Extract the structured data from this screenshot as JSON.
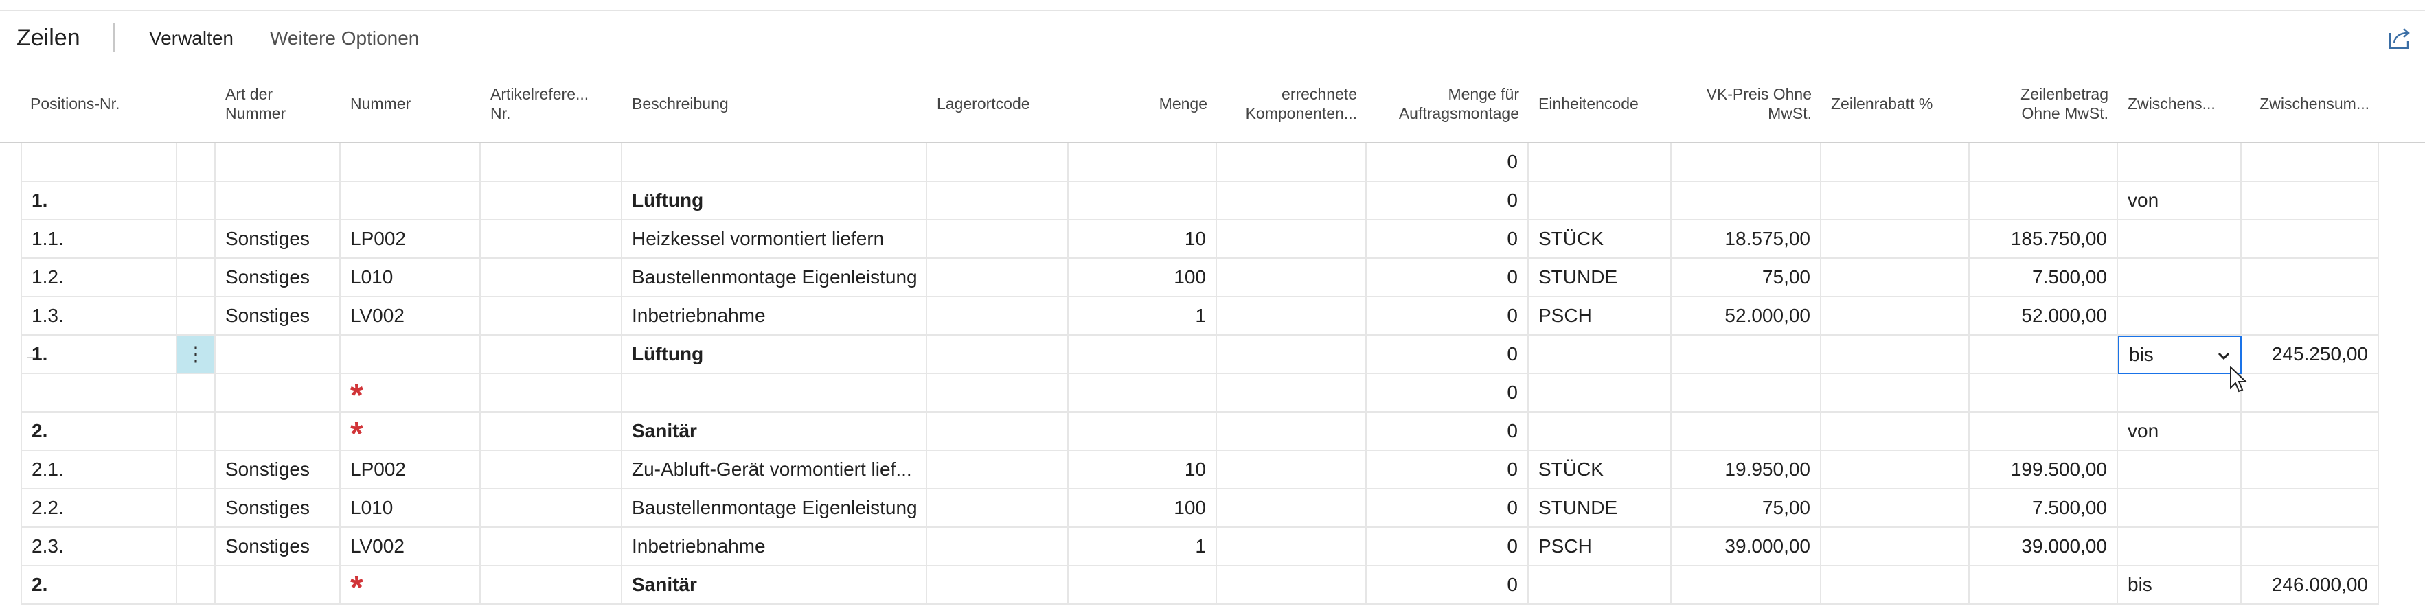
{
  "header": {
    "title": "Zeilen",
    "actions": [
      "Verwalten",
      "Weitere Optionen"
    ]
  },
  "columns": [
    {
      "label": "Positions-Nr."
    },
    {
      "label": ""
    },
    {
      "label": "Art der Nummer"
    },
    {
      "label": "Nummer"
    },
    {
      "label": "Artikelrefere... Nr."
    },
    {
      "label": "Beschreibung"
    },
    {
      "label": "Lagerortcode"
    },
    {
      "label": "Menge"
    },
    {
      "label": "errechnete Komponenten..."
    },
    {
      "label": "Menge für Auftragsmontage"
    },
    {
      "label": "Einheitencode"
    },
    {
      "label": "VK-Preis Ohne MwSt."
    },
    {
      "label": "Zeilenrabatt %"
    },
    {
      "label": "Zeilenbetrag Ohne MwSt."
    },
    {
      "label": "Zwischens..."
    },
    {
      "label": "Zwischensum..."
    }
  ],
  "rows": [
    {
      "pos": "",
      "art": "",
      "nummer": "",
      "beschreibung": "",
      "menge": "",
      "montage": "0",
      "einheit": "",
      "preis": "",
      "betrag": "",
      "zw": "",
      "zwsum": "",
      "bold": false,
      "star": false
    },
    {
      "pos": "1.",
      "art": "",
      "nummer": "",
      "beschreibung": "Lüftung",
      "menge": "",
      "montage": "0",
      "einheit": "",
      "preis": "",
      "betrag": "",
      "zw": "von",
      "zwsum": "",
      "bold": true,
      "star": false
    },
    {
      "pos": "1.1.",
      "art": "Sonstiges",
      "nummer": "LP002",
      "beschreibung": "Heizkessel vormontiert liefern",
      "menge": "10",
      "montage": "0",
      "einheit": "STÜCK",
      "preis": "18.575,00",
      "betrag": "185.750,00",
      "zw": "",
      "zwsum": "",
      "bold": false,
      "star": false
    },
    {
      "pos": "1.2.",
      "art": "Sonstiges",
      "nummer": "L010",
      "beschreibung": "Baustellenmontage Eigenleistung",
      "menge": "100",
      "montage": "0",
      "einheit": "STUNDE",
      "preis": "75,00",
      "betrag": "7.500,00",
      "zw": "",
      "zwsum": "",
      "bold": false,
      "star": false
    },
    {
      "pos": "1.3.",
      "art": "Sonstiges",
      "nummer": "LV002",
      "beschreibung": "Inbetriebnahme",
      "menge": "1",
      "montage": "0",
      "einheit": "PSCH",
      "preis": "52.000,00",
      "betrag": "52.000,00",
      "zw": "",
      "zwsum": "",
      "bold": false,
      "star": false
    },
    {
      "pos": "1.",
      "art": "",
      "nummer": "",
      "beschreibung": "Lüftung",
      "menge": "",
      "montage": "0",
      "einheit": "",
      "preis": "",
      "betrag": "",
      "zw": "bis",
      "zwsum": "245.250,00",
      "bold": true,
      "star": false,
      "current": true
    },
    {
      "pos": "",
      "art": "",
      "nummer": "",
      "beschreibung": "",
      "menge": "",
      "montage": "0",
      "einheit": "",
      "preis": "",
      "betrag": "",
      "zw": "",
      "zwsum": "",
      "bold": false,
      "star": true
    },
    {
      "pos": "2.",
      "art": "",
      "nummer": "",
      "beschreibung": "Sanitär",
      "menge": "",
      "montage": "0",
      "einheit": "",
      "preis": "",
      "betrag": "",
      "zw": "von",
      "zwsum": "",
      "bold": true,
      "star": true
    },
    {
      "pos": "2.1.",
      "art": "Sonstiges",
      "nummer": "LP002",
      "beschreibung": "Zu-Abluft-Gerät vormontiert lief...",
      "menge": "10",
      "montage": "0",
      "einheit": "STÜCK",
      "preis": "19.950,00",
      "betrag": "199.500,00",
      "zw": "",
      "zwsum": "",
      "bold": false,
      "star": false
    },
    {
      "pos": "2.2.",
      "art": "Sonstiges",
      "nummer": "L010",
      "beschreibung": "Baustellenmontage Eigenleistung",
      "menge": "100",
      "montage": "0",
      "einheit": "STUNDE",
      "preis": "75,00",
      "betrag": "7.500,00",
      "zw": "",
      "zwsum": "",
      "bold": false,
      "star": false
    },
    {
      "pos": "2.3.",
      "art": "Sonstiges",
      "nummer": "LV002",
      "beschreibung": "Inbetriebnahme",
      "menge": "1",
      "montage": "0",
      "einheit": "PSCH",
      "preis": "39.000,00",
      "betrag": "39.000,00",
      "zw": "",
      "zwsum": "",
      "bold": false,
      "star": false
    },
    {
      "pos": "2.",
      "art": "",
      "nummer": "",
      "beschreibung": "Sanitär",
      "menge": "",
      "montage": "0",
      "einheit": "",
      "preis": "",
      "betrag": "",
      "zw": "bis",
      "zwsum": "246.000,00",
      "bold": true,
      "star": true
    }
  ],
  "icons": {
    "share": "share-icon",
    "current_row": "arrow-right-icon",
    "row_menu": "more-vertical-icon",
    "required": "asterisk-icon",
    "dropdown": "chevron-down-icon"
  },
  "colors": {
    "selection": "#c1e6ef",
    "required_star": "#d13438",
    "focus_border": "#1a73e8"
  }
}
